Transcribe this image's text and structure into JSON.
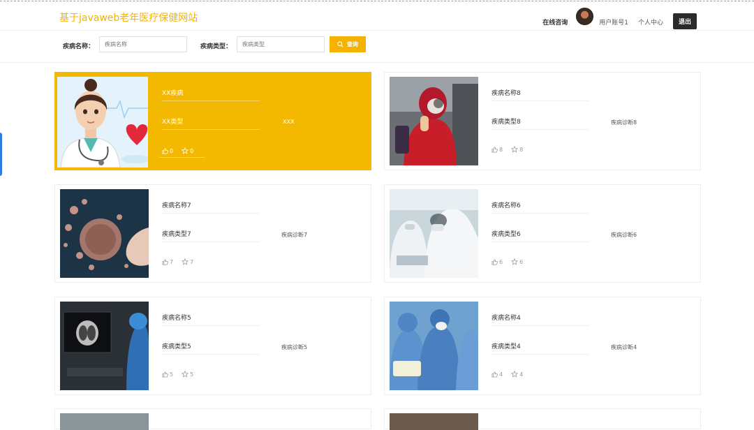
{
  "header": {
    "site_title": "基于javaweb老年医疗保健网站",
    "nav_consult": "在线咨询",
    "nav_user": "用户账号1",
    "nav_profile": "个人中心",
    "logout": "退出"
  },
  "search": {
    "name_label": "疾病名称：",
    "name_placeholder": "疾病名称",
    "type_label": "疾病类型：",
    "type_placeholder": "疾病类型",
    "button": "查询"
  },
  "cards": [
    {
      "name": "XX疾病",
      "type": "XX类型",
      "diagnosis": "XXX",
      "likes": "0",
      "favorites": "0",
      "highlighted": true,
      "image": "cartoon-doctor-image"
    },
    {
      "name": "疾病名称8",
      "type": "疾病类型8",
      "diagnosis": "疾病诊断8",
      "likes": "8",
      "favorites": "8",
      "image": "medical-worker-thumbs-up-image"
    },
    {
      "name": "疾病名称7",
      "type": "疾病类型7",
      "diagnosis": "疾病诊断7",
      "likes": "7",
      "favorites": "7",
      "image": "virus-illustration-image"
    },
    {
      "name": "疾病名称6",
      "type": "疾病类型6",
      "diagnosis": "疾病诊断6",
      "likes": "6",
      "favorites": "6",
      "image": "protective-suit-staff-image"
    },
    {
      "name": "疾病名称5",
      "type": "疾病类型5",
      "diagnosis": "疾病诊断5",
      "likes": "5",
      "favorites": "5",
      "image": "lung-ct-scan-image"
    },
    {
      "name": "疾病名称4",
      "type": "疾病类型4",
      "diagnosis": "疾病诊断4",
      "likes": "4",
      "favorites": "4",
      "image": "medical-team-image"
    }
  ],
  "colors": {
    "accent": "#f3b300",
    "logout_bg": "#2b2b2b",
    "side_tab": "#2f7de1"
  }
}
